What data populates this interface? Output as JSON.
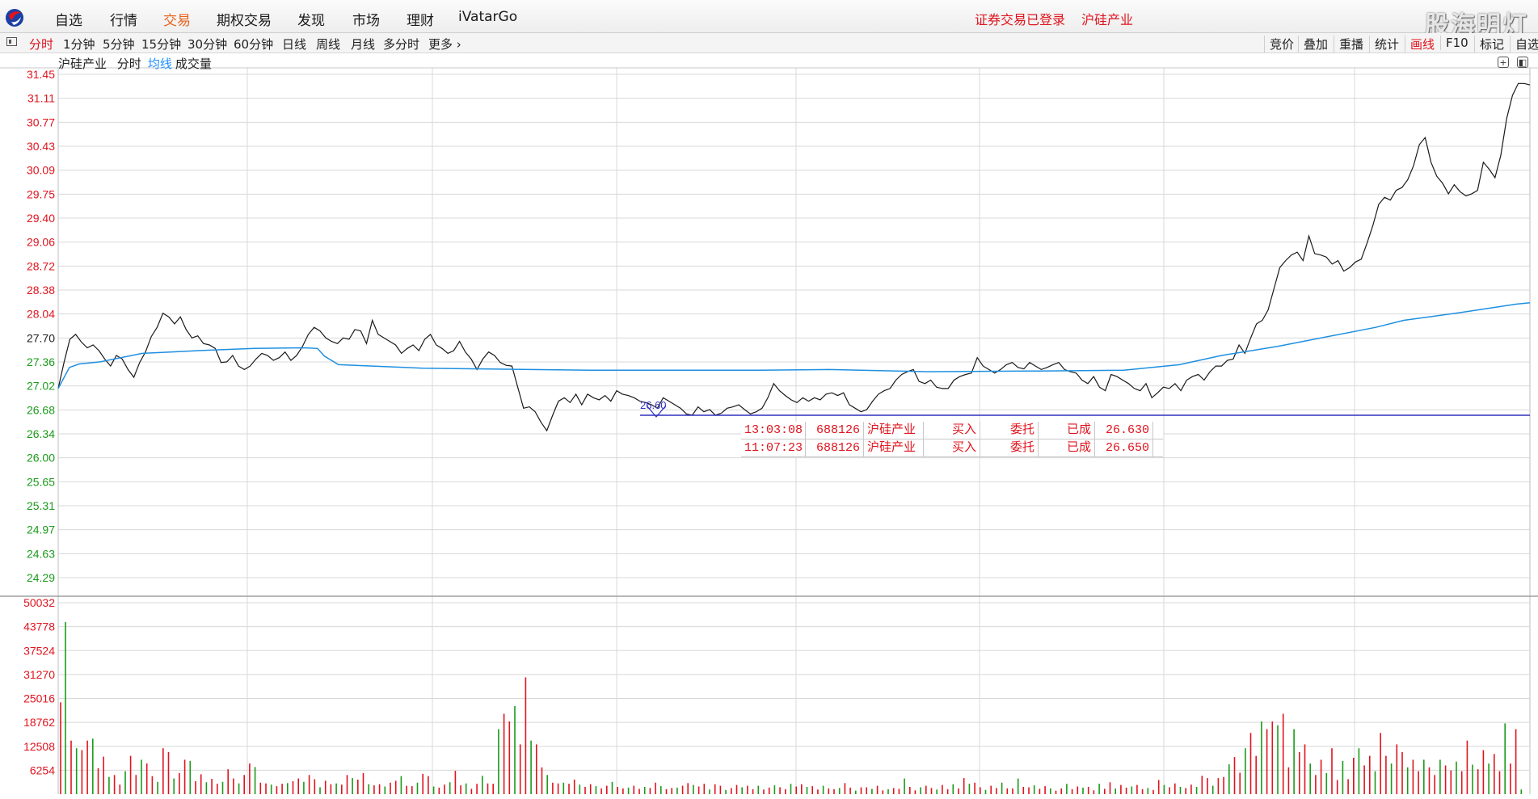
{
  "menubar": {
    "items": [
      "自选",
      "行情",
      "交易",
      "期权交易",
      "发现",
      "市场",
      "理财",
      "iVatarGo"
    ],
    "active_item": "交易",
    "status_login": "证券交易已登录",
    "status_stock": "沪硅产业",
    "watermark": "股海明灯"
  },
  "periods": {
    "items": [
      "分时",
      "1分钟",
      "5分钟",
      "15分钟",
      "30分钟",
      "60分钟",
      "日线",
      "周线",
      "月线",
      "多分时",
      "更多"
    ],
    "active": "分时",
    "more_arrow": "›"
  },
  "tools": {
    "items": [
      "竞价",
      "叠加",
      "重播",
      "统计",
      "画线",
      "F10",
      "标记",
      "自选"
    ],
    "active": "画线"
  },
  "chart_header": {
    "stock_name": "沪硅产业",
    "mode": "分时",
    "ma_label": "均线",
    "volume_label": "成交量"
  },
  "chart_data": {
    "type": "line",
    "price_axis_ticks": [
      "31.45",
      "31.11",
      "30.77",
      "30.43",
      "30.09",
      "29.75",
      "29.40",
      "29.06",
      "28.72",
      "28.38",
      "28.04",
      "27.70",
      "27.36",
      "27.02",
      "26.68",
      "26.34",
      "26.00",
      "25.65",
      "25.31",
      "24.97",
      "24.63",
      "24.29"
    ],
    "price_axis_colors": [
      "#e0141e",
      "#e0141e",
      "#e0141e",
      "#e0141e",
      "#e0141e",
      "#e0141e",
      "#e0141e",
      "#e0141e",
      "#e0141e",
      "#e0141e",
      "#e0141e",
      "#222222",
      "#1a9b1a",
      "#1a9b1a",
      "#1a9b1a",
      "#1a9b1a",
      "#1a9b1a",
      "#1a9b1a",
      "#1a9b1a",
      "#1a9b1a",
      "#1a9b1a",
      "#1a9b1a"
    ],
    "ylim": [
      24.29,
      31.45
    ],
    "volume_axis_ticks": [
      "50032",
      "43778",
      "37524",
      "31270",
      "25016",
      "18762",
      "12508",
      "6254"
    ],
    "volume_ylim": [
      0,
      50032
    ],
    "price_series": [
      26.98,
      27.35,
      27.68,
      27.75,
      27.64,
      27.56,
      27.6,
      27.52,
      27.4,
      27.3,
      27.45,
      27.4,
      27.25,
      27.14,
      27.35,
      27.5,
      27.72,
      27.85,
      28.05,
      28.0,
      27.9,
      28.0,
      27.82,
      27.7,
      27.73,
      27.62,
      27.6,
      27.55,
      27.35,
      27.36,
      27.45,
      27.3,
      27.25,
      27.3,
      27.4,
      27.48,
      27.45,
      27.38,
      27.42,
      27.5,
      27.38,
      27.45,
      27.58,
      27.75,
      27.85,
      27.8,
      27.7,
      27.65,
      27.62,
      27.7,
      27.68,
      27.82,
      27.8,
      27.62,
      27.95,
      27.75,
      27.7,
      27.65,
      27.6,
      27.48,
      27.55,
      27.6,
      27.52,
      27.68,
      27.75,
      27.6,
      27.55,
      27.48,
      27.52,
      27.65,
      27.5,
      27.4,
      27.25,
      27.4,
      27.5,
      27.45,
      27.35,
      27.31,
      27.3,
      27.0,
      26.7,
      26.72,
      26.65,
      26.5,
      26.38,
      26.6,
      26.8,
      26.85,
      26.78,
      26.9,
      26.75,
      26.9,
      26.85,
      26.82,
      26.88,
      26.8,
      26.95,
      26.9,
      26.88,
      26.85,
      26.8,
      26.78,
      26.75,
      26.7,
      26.85,
      26.8,
      26.75,
      26.7,
      26.62,
      26.6,
      26.72,
      26.65,
      26.68,
      26.6,
      26.63,
      26.7,
      26.72,
      26.75,
      26.68,
      26.62,
      26.65,
      26.7,
      26.85,
      27.05,
      26.95,
      26.88,
      26.82,
      26.78,
      26.85,
      26.8,
      26.85,
      26.82,
      26.9,
      26.92,
      26.88,
      26.92,
      26.75,
      26.7,
      26.65,
      26.68,
      26.8,
      26.9,
      26.95,
      26.98,
      27.1,
      27.18,
      27.22,
      27.25,
      27.08,
      27.05,
      27.1,
      27.0,
      26.98,
      26.98,
      27.1,
      27.15,
      27.18,
      27.2,
      27.42,
      27.3,
      27.25,
      27.2,
      27.25,
      27.32,
      27.35,
      27.28,
      27.26,
      27.35,
      27.3,
      27.25,
      27.28,
      27.32,
      27.35,
      27.25,
      27.22,
      27.2,
      27.1,
      27.05,
      27.15,
      27.0,
      26.95,
      27.18,
      27.15,
      27.1,
      27.05,
      26.98,
      26.95,
      27.05,
      26.85,
      26.92,
      27.0,
      26.98,
      27.05,
      26.95,
      27.1,
      27.15,
      27.18,
      27.1,
      27.22,
      27.3,
      27.3,
      27.38,
      27.4,
      27.6,
      27.48,
      27.7,
      27.9,
      27.95,
      28.1,
      28.4,
      28.7,
      28.8,
      28.88,
      28.92,
      28.8,
      29.15,
      28.9,
      28.88,
      28.85,
      28.75,
      28.8,
      28.65,
      28.7,
      28.78,
      28.82,
      29.05,
      29.3,
      29.6,
      29.7,
      29.66,
      29.8,
      29.84,
      29.95,
      30.15,
      30.45,
      30.55,
      30.2,
      30.0,
      29.9,
      29.75,
      29.88,
      29.78,
      29.72,
      29.75,
      29.8,
      30.2,
      30.1,
      29.98,
      30.3,
      30.82,
      31.15,
      31.32,
      31.32,
      31.3
    ],
    "avg_series_points": [
      [
        0,
        26.98
      ],
      [
        8,
        27.28
      ],
      [
        15,
        27.33
      ],
      [
        30,
        27.36
      ],
      [
        60,
        27.48
      ],
      [
        80,
        27.5
      ],
      [
        100,
        27.52
      ],
      [
        140,
        27.55
      ],
      [
        175,
        27.56
      ],
      [
        185,
        27.55
      ],
      [
        190,
        27.44
      ],
      [
        200,
        27.32
      ],
      [
        260,
        27.27
      ],
      [
        380,
        27.24
      ],
      [
        500,
        27.24
      ],
      [
        550,
        27.25
      ],
      [
        620,
        27.22
      ],
      [
        700,
        27.23
      ],
      [
        760,
        27.24
      ],
      [
        800,
        27.32
      ],
      [
        830,
        27.45
      ],
      [
        870,
        27.58
      ],
      [
        940,
        27.85
      ],
      [
        960,
        27.95
      ],
      [
        1000,
        28.06
      ],
      [
        1040,
        28.18
      ],
      [
        1050,
        28.2
      ]
    ],
    "volume_series": [
      [
        24000,
        45000
      ],
      [
        14000,
        12000,
        11500,
        14000,
        14500,
        6800,
        9800,
        4500,
        5000,
        2500,
        6000,
        10000,
        5000,
        9000,
        8000,
        4700,
        3200,
        12000,
        11000,
        4100,
        5500,
        9000,
        8700,
        3400,
        5200,
        3100,
        4000,
        2700,
        3200,
        6500,
        4100,
        2800,
        5000,
        8000,
        7100,
        3000,
        2800,
        2500,
        2100,
        2700,
        2900,
        3400,
        4100,
        3200,
        5000,
        3900,
        1800,
        3500,
        2600,
        2800,
        2500,
        5000,
        4200,
        3800,
        5500,
        2600,
        2300,
        2600,
        2000,
        3000,
        3500,
        4700,
        2200,
        2100,
        3000,
        5300,
        4700,
        2000,
        1700,
        2500,
        3100,
        6100,
        2300,
        2800,
        1400,
        2700,
        4800,
        2800,
        2700,
        17000,
        21000,
        19000,
        23000,
        13000,
        30500,
        14000,
        13000,
        7000,
        5000,
        3000,
        2800,
        3000,
        2700,
        3800,
        2500,
        1900,
        2600,
        2100,
        1500,
        2200,
        3200,
        1900,
        1500,
        1700,
        2200,
        1400,
        1900,
        1600,
        3000,
        2100,
        1300,
        1600,
        1700,
        2200,
        2900,
        2400,
        2000,
        2700,
        1200,
        2600,
        2200,
        1100,
        1600,
        2400,
        1800,
        2200,
        1300,
        2200,
        1200,
        1700,
        2300,
        1800,
        1300,
        2700,
        2000,
        2600,
        1900,
        2100,
        1200,
        2200,
        1500,
        1300,
        1600,
        2900,
        1700,
        900,
        1800,
        1800,
        1400,
        2200,
        1000,
        1300,
        1600,
        1400,
        4100,
        1900,
        1000,
        1800,
        2200,
        1600,
        1200,
        2400,
        1300,
        2600,
        1500,
        4200,
        2700,
        3000,
        1800,
        1100,
        2200,
        1600,
        3000,
        1500,
        1500,
        4100,
        1900,
        1800,
        2300,
        1400,
        2100,
        1500,
        900,
        1500,
        2700,
        1300,
        2000,
        1700,
        1900,
        1000,
        2700,
        1400,
        3100,
        1500,
        2400,
        1700,
        2000,
        2400,
        1300,
        1600,
        1100,
        3700,
        2400,
        1800,
        2800,
        1900,
        1600,
        2500,
        1900,
        4800,
        4200,
        2200,
        4200,
        4500,
        7800,
        9700,
        5600,
        12000,
        16000,
        10000,
        19000,
        17000,
        19000,
        18000,
        21000,
        7000,
        17000,
        11000,
        13000,
        8000,
        5000,
        9000,
        5500,
        12000,
        3700,
        8700,
        3900,
        9500,
        12000,
        7500,
        10000,
        6000,
        16000,
        10000,
        8000,
        13000,
        11000,
        7000,
        9000,
        6000,
        9000,
        7000,
        5000,
        9000,
        7500,
        6200,
        8500,
        6000,
        14000,
        7700,
        6500,
        11500,
        8000,
        10500,
        6000,
        18500,
        8000,
        17000,
        1200
      ]
    ],
    "annotation_price": "26.60",
    "annotation_level": 26.6
  },
  "trade_records": [
    {
      "time": "13:03:08",
      "code": "688126",
      "name": "沪硅产业",
      "side": "买入",
      "type": "委托",
      "status": "已成",
      "price": "26.630"
    },
    {
      "time": "11:07:23",
      "code": "688126",
      "name": "沪硅产业",
      "side": "买入",
      "type": "委托",
      "status": "已成",
      "price": "26.650"
    }
  ],
  "colors": {
    "price_line": "#1a1a1a",
    "avg_line": "#1e8fe0",
    "up": "#e0141e",
    "down": "#1a9b1a",
    "annotation": "#3030c0",
    "grid": "#d8d8d8"
  }
}
